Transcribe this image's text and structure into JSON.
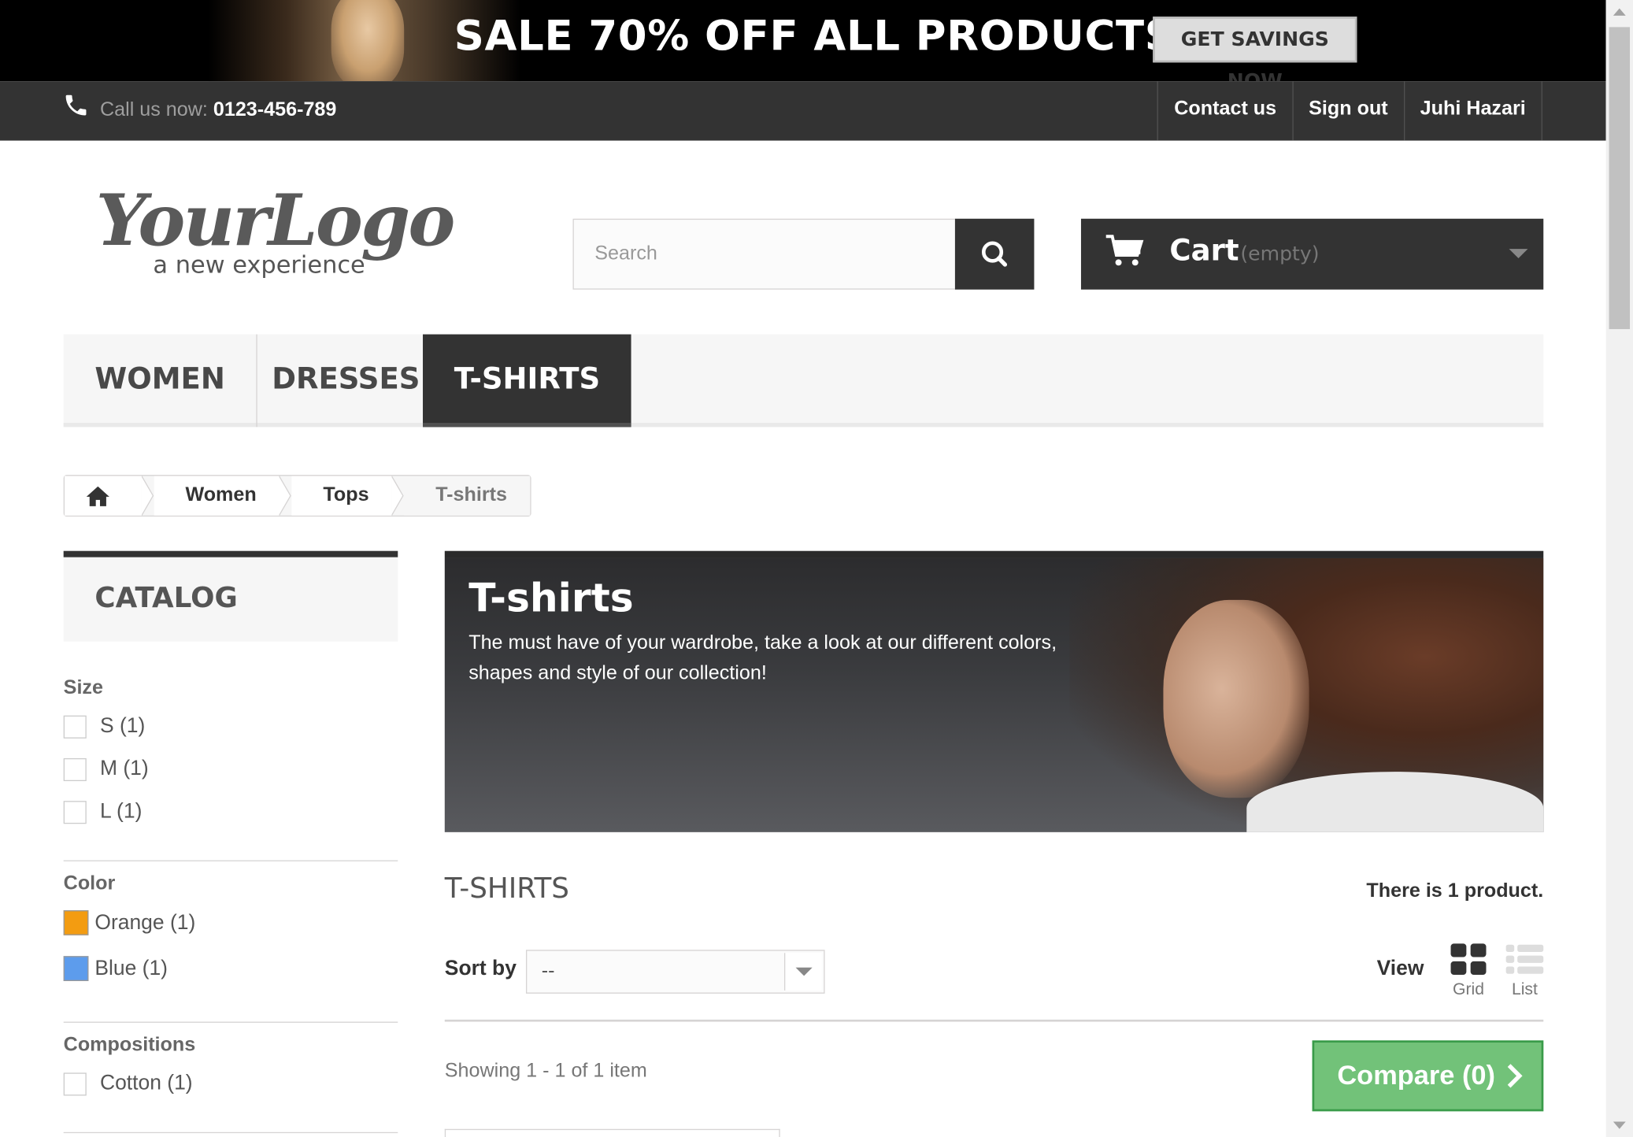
{
  "banner": {
    "text": "SALE 70% OFF ALL PRODUCTS",
    "button": "GET SAVINGS NOW"
  },
  "nav": {
    "call_label": "Call us now: ",
    "phone": "0123-456-789",
    "links": [
      "Contact us",
      "Sign out",
      "Juhi Hazari"
    ]
  },
  "header": {
    "logo_main": "YourLogo",
    "logo_tagline": "a new experience",
    "search_placeholder": "Search",
    "cart_label": "Cart",
    "cart_status": "(empty)"
  },
  "menu": [
    "WOMEN",
    "DRESSES",
    "T-SHIRTS"
  ],
  "breadcrumb": [
    "Women",
    "Tops",
    "T-shirts"
  ],
  "sidebar": {
    "title": "CATALOG",
    "size_label": "Size",
    "sizes": [
      "S (1)",
      "M (1)",
      "L (1)"
    ],
    "color_label": "Color",
    "colors": [
      {
        "label": "Orange (1)",
        "hex": "#f39c11"
      },
      {
        "label": "Blue (1)",
        "hex": "#5d9cec"
      }
    ],
    "compositions_label": "Compositions",
    "compositions": [
      "Cotton (1)"
    ]
  },
  "category": {
    "title": "T-shirts",
    "description": "The must have of your wardrobe, take a look at our different colors, shapes and style of our collection!"
  },
  "listing": {
    "heading": "T-SHIRTS",
    "count": "There is 1 product.",
    "sort_label": "Sort by",
    "sort_value": "--",
    "view_label": "View",
    "view_grid": "Grid",
    "view_list": "List",
    "showing": "Showing 1 - 1 of 1 item",
    "compare": "Compare (0)"
  },
  "colors": {
    "dark": "#333333",
    "compare_green": "#72c279"
  }
}
